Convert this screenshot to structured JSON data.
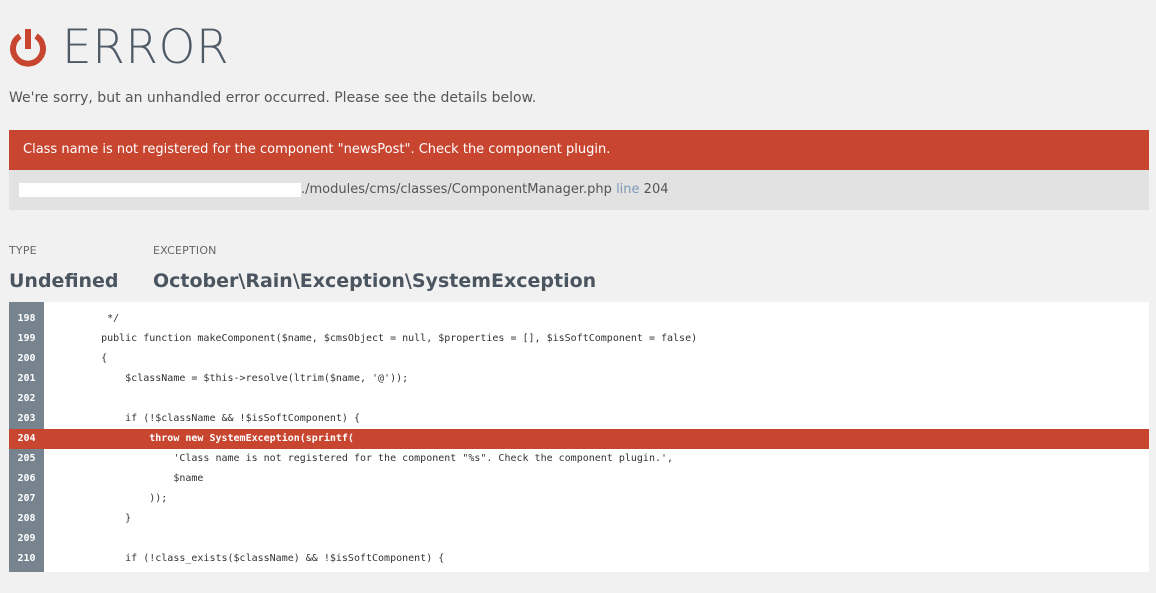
{
  "header": {
    "title": "ERROR",
    "subtitle": "We're sorry, but an unhandled error occurred. Please see the details below.",
    "icon": "power-icon",
    "accent_color": "#c84530"
  },
  "error": {
    "message": "Class name is not registered for the component \"newsPost\". Check the component plugin.",
    "file_path": "./modules/cms/classes/ComponentManager.php",
    "line_label": "line",
    "line_number": "204"
  },
  "details": {
    "type_label": "TYPE",
    "type_value": "Undefined",
    "exception_label": "EXCEPTION",
    "exception_value": "October\\Rain\\Exception\\SystemException"
  },
  "code": {
    "lines": [
      {
        "number": "198",
        "text": "     */",
        "highlight": false
      },
      {
        "number": "199",
        "text": "    public function makeComponent($name, $cmsObject = null, $properties = [], $isSoftComponent = false)",
        "highlight": false
      },
      {
        "number": "200",
        "text": "    {",
        "highlight": false
      },
      {
        "number": "201",
        "text": "        $className = $this->resolve(ltrim($name, '@'));",
        "highlight": false
      },
      {
        "number": "202",
        "text": "",
        "highlight": false
      },
      {
        "number": "203",
        "text": "        if (!$className && !$isSoftComponent) {",
        "highlight": false
      },
      {
        "number": "204",
        "text": "            throw new SystemException(sprintf(",
        "highlight": true
      },
      {
        "number": "205",
        "text": "                'Class name is not registered for the component \"%s\". Check the component plugin.',",
        "highlight": false
      },
      {
        "number": "206",
        "text": "                $name",
        "highlight": false
      },
      {
        "number": "207",
        "text": "            ));",
        "highlight": false
      },
      {
        "number": "208",
        "text": "        }",
        "highlight": false
      },
      {
        "number": "209",
        "text": "",
        "highlight": false
      },
      {
        "number": "210",
        "text": "        if (!class_exists($className) && !$isSoftComponent) {",
        "highlight": false
      }
    ]
  }
}
